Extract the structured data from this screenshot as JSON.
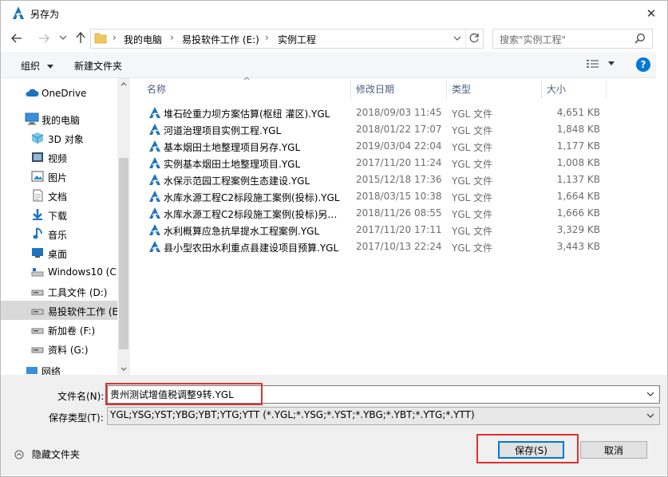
{
  "window": {
    "title": "另存为",
    "close_glyph": "✕"
  },
  "nav": {
    "path": [
      "我的电脑",
      "易投软件工作 (E:)",
      "实例工程"
    ],
    "search_placeholder": "搜索\"实例工程\""
  },
  "toolbar": {
    "organize_label": "组织",
    "new_folder_label": "新建文件夹"
  },
  "sidebar": {
    "items": [
      {
        "label": "OneDrive",
        "icon": "cloud-icon"
      },
      {
        "label": "我的电脑",
        "icon": "computer-icon"
      },
      {
        "label": "3D 对象",
        "icon": "cube-icon"
      },
      {
        "label": "视频",
        "icon": "video-icon"
      },
      {
        "label": "图片",
        "icon": "picture-icon"
      },
      {
        "label": "文档",
        "icon": "document-icon"
      },
      {
        "label": "下载",
        "icon": "download-icon"
      },
      {
        "label": "音乐",
        "icon": "music-icon"
      },
      {
        "label": "桌面",
        "icon": "desktop-icon"
      },
      {
        "label": "Windows10 (C:",
        "icon": "drive-icon"
      },
      {
        "label": "工具文件 (D:)",
        "icon": "drive-icon"
      },
      {
        "label": "易投软件工作 (E",
        "icon": "drive-icon",
        "selected": true
      },
      {
        "label": "新加卷 (F:)",
        "icon": "drive-icon"
      },
      {
        "label": "资料 (G:)",
        "icon": "drive-icon"
      },
      {
        "label": "网络",
        "icon": "network-icon"
      }
    ]
  },
  "columns": {
    "name": "名称",
    "date": "修改日期",
    "type": "类型",
    "size": "大小"
  },
  "files": [
    {
      "name": "堆石砼重力坝方案估算(枢纽 灌区).YGL",
      "date": "2018/09/03 11:45",
      "type": "YGL 文件",
      "size": "4,651 KB"
    },
    {
      "name": "河道治理项目实例工程.YGL",
      "date": "2018/01/22 17:07",
      "type": "YGL 文件",
      "size": "1,848 KB"
    },
    {
      "name": "基本烟田土地整理项目另存.YGL",
      "date": "2019/03/04 22:04",
      "type": "YGL 文件",
      "size": "1,177 KB"
    },
    {
      "name": "实例基本烟田土地整理项目.YGL",
      "date": "2017/11/20 11:24",
      "type": "YGL 文件",
      "size": "1,008 KB"
    },
    {
      "name": "水保示范园工程案例生态建设.YGL",
      "date": "2015/12/18 17:36",
      "type": "YGL 文件",
      "size": "1,137 KB"
    },
    {
      "name": "水库水源工程C2标段施工案例(投标).YGL",
      "date": "2018/03/15 10:38",
      "type": "YGL 文件",
      "size": "1,664 KB"
    },
    {
      "name": "水库水源工程C2标段施工案例(投标)另存...",
      "date": "2018/11/26 08:55",
      "type": "YGL 文件",
      "size": "1,666 KB"
    },
    {
      "name": "水利概算应急抗旱提水工程案例.YGL",
      "date": "2017/11/20 17:11",
      "type": "YGL 文件",
      "size": "3,329 KB"
    },
    {
      "name": "县小型农田水利重点县建设项目预算.YGL",
      "date": "2017/10/13 22:24",
      "type": "YGL 文件",
      "size": "3,443 KB"
    }
  ],
  "form": {
    "filename_label": "文件名(N):",
    "filename_value": "贵州测试增值税调整9转.YGL",
    "filetype_label": "保存类型(T):",
    "filetype_value": "YGL;YSG;YST;YBG;YBT;YTG;YTT (*.YGL;*.YSG;*.YST;*.YBG;*.YBT;*.YTG;*.YTT)"
  },
  "footer": {
    "hide_folders_label": "隐藏文件夹",
    "save_label": "保存(S)",
    "cancel_label": "取消"
  },
  "colors": {
    "accent": "#0078d7",
    "highlight": "#e0312d",
    "app_icon": "#1e73be"
  }
}
